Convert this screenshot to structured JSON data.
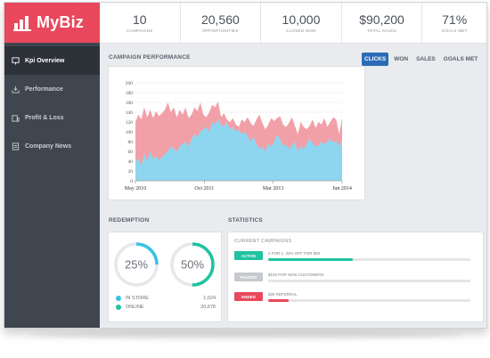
{
  "brand": {
    "name": "MyBiz",
    "color": "#e9485c"
  },
  "sidebar": {
    "items": [
      {
        "label": "Kpi Overview",
        "icon": "presentation-icon",
        "active": true
      },
      {
        "label": "Performance",
        "icon": "download-tray-icon",
        "active": false
      },
      {
        "label": "Profit & Loss",
        "icon": "building-icon",
        "active": false
      },
      {
        "label": "Company News",
        "icon": "document-icon",
        "active": false
      }
    ]
  },
  "stats": [
    {
      "value": "10",
      "label": "CAMPAIGNS"
    },
    {
      "value": "20,560",
      "label": "OPPORTUNITIES"
    },
    {
      "value": "10,000",
      "label": "CLOSED WON"
    },
    {
      "value": "$90,200",
      "label": "TOTAL SALES"
    },
    {
      "value": "71%",
      "label": "GOALS MET"
    }
  ],
  "performance": {
    "title": "CAMPAIGN PERFORMANCE",
    "tabs": [
      "CLICKS",
      "WON",
      "SALES",
      "GOALS MET"
    ],
    "active_tab": "CLICKS"
  },
  "chart_data": {
    "type": "area",
    "y_ticks": [
      0,
      20,
      40,
      60,
      80,
      100,
      120,
      140,
      160,
      180,
      200
    ],
    "ylim": [
      0,
      200
    ],
    "x_tick_labels": [
      "May 2010",
      "Oct 2011",
      "Mar 2013",
      "Jun 2014"
    ],
    "series": [
      {
        "color": "#f2a0a8",
        "values": [
          120,
          135,
          125,
          150,
          130,
          145,
          128,
          142,
          132,
          138,
          145,
          160,
          140,
          150,
          130,
          145,
          135,
          150,
          128,
          135,
          150,
          142,
          160,
          135,
          130,
          140,
          155,
          150,
          162,
          130,
          138,
          125,
          120,
          128,
          115,
          110,
          125,
          120,
          130,
          118,
          112,
          125,
          135,
          118,
          105,
          115,
          128,
          122,
          128,
          132,
          115,
          110,
          118,
          130,
          112,
          95,
          120,
          110,
          105,
          112,
          125,
          108,
          120,
          115,
          128,
          110,
          120,
          130,
          125,
          95,
          128
        ]
      },
      {
        "color": "#8ed6ef",
        "values": [
          40,
          45,
          30,
          55,
          40,
          60,
          45,
          50,
          42,
          48,
          55,
          60,
          70,
          65,
          60,
          70,
          75,
          80,
          70,
          85,
          95,
          90,
          100,
          105,
          110,
          100,
          120,
          115,
          125,
          115,
          110,
          120,
          105,
          110,
          100,
          105,
          95,
          100,
          92,
          80,
          90,
          75,
          65,
          70,
          60,
          75,
          70,
          80,
          95,
          85,
          70,
          75,
          65,
          72,
          80,
          60,
          70,
          65,
          75,
          85,
          78,
          70,
          72,
          80,
          75,
          80,
          85,
          78,
          82,
          70,
          85
        ]
      }
    ]
  },
  "redemption": {
    "title": "REDEMPTION",
    "gauges": [
      {
        "value_text": "25%",
        "fraction": 0.25
      },
      {
        "value_text": "50%",
        "fraction": 0.5
      }
    ],
    "legend": [
      {
        "label": "IN STORE",
        "value": "1,024"
      },
      {
        "label": "ONLINE",
        "value": "20,678"
      }
    ],
    "colors": {
      "store": "#36c3e3",
      "online": "#1fc3a0",
      "track": "#e6e8eb"
    }
  },
  "statistics": {
    "title": "STATISTICS",
    "subtitle": "CURRENT CAMPAIGNS",
    "campaigns": [
      {
        "status": "ACTIVE",
        "status_color": "#1fc3a0",
        "text": "2 FOR 1, 30% OFF FOR $50",
        "progress": 0.42,
        "bar_color": "#1fc3a0"
      },
      {
        "status": "PAUSED",
        "status_color": "#c6c9cd",
        "text": "$100 FOR NEW CUSTOMERS",
        "progress": 0.0,
        "bar_color": "#c6c9cd"
      },
      {
        "status": "ENDED",
        "status_color": "#e9485c",
        "text": "$25 REFERRAL",
        "progress": 0.1,
        "bar_color": "#e9485c"
      }
    ]
  }
}
